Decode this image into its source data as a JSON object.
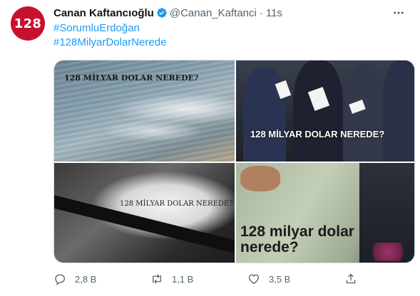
{
  "user": {
    "avatar_text": "128",
    "name": "Canan Kaftancıoğlu",
    "handle": "@Canan_Kaftanci",
    "separator": "·",
    "time": "11s"
  },
  "tweet": {
    "hashtags": [
      "#SorumluErdoğan",
      "#128MilyarDolarNerede"
    ]
  },
  "media": {
    "images": [
      {
        "caption": "128 MİLYAR DOLAR NEREDE?"
      },
      {
        "caption": "128 MİLYAR DOLAR NEREDE?"
      },
      {
        "caption": "128 MİLYAR DOLAR NEREDE?"
      },
      {
        "caption": "128 milyar dolar nerede?"
      }
    ]
  },
  "actions": {
    "reply_count": "2,8 B",
    "retweet_count": "1,1 B",
    "like_count": "3,5 B"
  },
  "colors": {
    "accent": "#1d9bf0",
    "avatar_bg": "#c8102e",
    "text_secondary": "#536471"
  },
  "icons": [
    "verified-badge-icon",
    "more-icon",
    "reply-icon",
    "retweet-icon",
    "like-icon",
    "share-icon"
  ]
}
